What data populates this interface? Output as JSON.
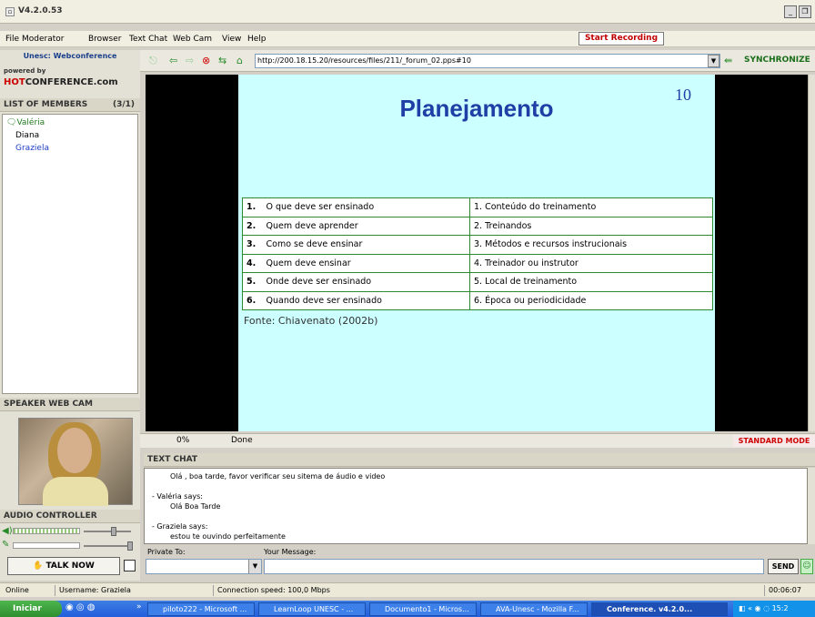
{
  "window": {
    "title": "V4.2.0.53"
  },
  "menu": [
    "File",
    "Moderator",
    "Browser",
    "Text Chat",
    "Web Cam",
    "View",
    "Help"
  ],
  "start_recording": "Start Recording",
  "left": {
    "brand_title": "Unesc: Webconference",
    "powered_by": "powered by",
    "brand_logo_a": "HOT",
    "brand_logo_b": "CONFERENCE.com",
    "members_title": "LIST OF MEMBERS",
    "members_count": "(3/1)",
    "members": [
      {
        "name": "Valéria",
        "color": "#1f7a1f"
      },
      {
        "name": "Diana",
        "color": "#000000"
      },
      {
        "name": "Graziela",
        "color": "#1e3ec8"
      }
    ],
    "speaker_cam_title": "SPEAKER WEB CAM",
    "audio_title": "AUDIO CONTROLLER",
    "talk_now": "TALK NOW"
  },
  "browser": {
    "url": "http://200.18.15.20/resources/files/211/_forum_02.pps#10",
    "sync": "SYNCHRONIZE"
  },
  "slide": {
    "title": "Planejamento",
    "number": "10",
    "rows": [
      {
        "n": "1.",
        "q": "O que deve ser ensinado",
        "a": "1. Conteúdo do treinamento"
      },
      {
        "n": "2.",
        "q": "Quem deve aprender",
        "a": "2. Treinandos"
      },
      {
        "n": "3.",
        "q": "Como se deve ensinar",
        "a": "3. Métodos e recursos instrucionais"
      },
      {
        "n": "4.",
        "q": "Quem deve ensinar",
        "a": "4. Treinador ou instrutor"
      },
      {
        "n": "5.",
        "q": "Onde deve ser ensinado",
        "a": "5. Local de treinamento"
      },
      {
        "n": "6.",
        "q": "Quando deve ser ensinado",
        "a": "6. Época ou periodicidade"
      }
    ],
    "source": "Fonte: Chiavenato (2002b)"
  },
  "status": {
    "progress": "0%",
    "state": "Done",
    "mode": "STANDARD MODE"
  },
  "chat": {
    "title": "TEXT CHAT",
    "lines": [
      {
        "text": "Olá , boa tarde, favor verificar seu sitema de áudio e video",
        "indent": true
      },
      {
        "text": "",
        "indent": false
      },
      {
        "text": "- Valéria says:",
        "indent": false
      },
      {
        "text": "Olá Boa Tarde",
        "indent": true
      },
      {
        "text": "",
        "indent": false
      },
      {
        "text": "- Graziela says:",
        "indent": false
      },
      {
        "text": "estou te ouvindo perfeitamente",
        "indent": true
      }
    ],
    "private_to_label": "Private To:",
    "message_label": "Your Message:",
    "send": "SEND"
  },
  "statusbar": {
    "online": "Online",
    "username": "Username: Graziela",
    "speed": "Connection speed: 100,0 Mbps",
    "timer": "00:06:07"
  },
  "taskbar": {
    "start": "Iniciar",
    "tasks": [
      "piloto222 - Microsoft ...",
      "LearnLoop UNESC - ...",
      "Documento1 - Micros...",
      "AVA-Unesc - Mozilla F...",
      "Conference. v4.2.0..."
    ],
    "clock": "15:2"
  }
}
